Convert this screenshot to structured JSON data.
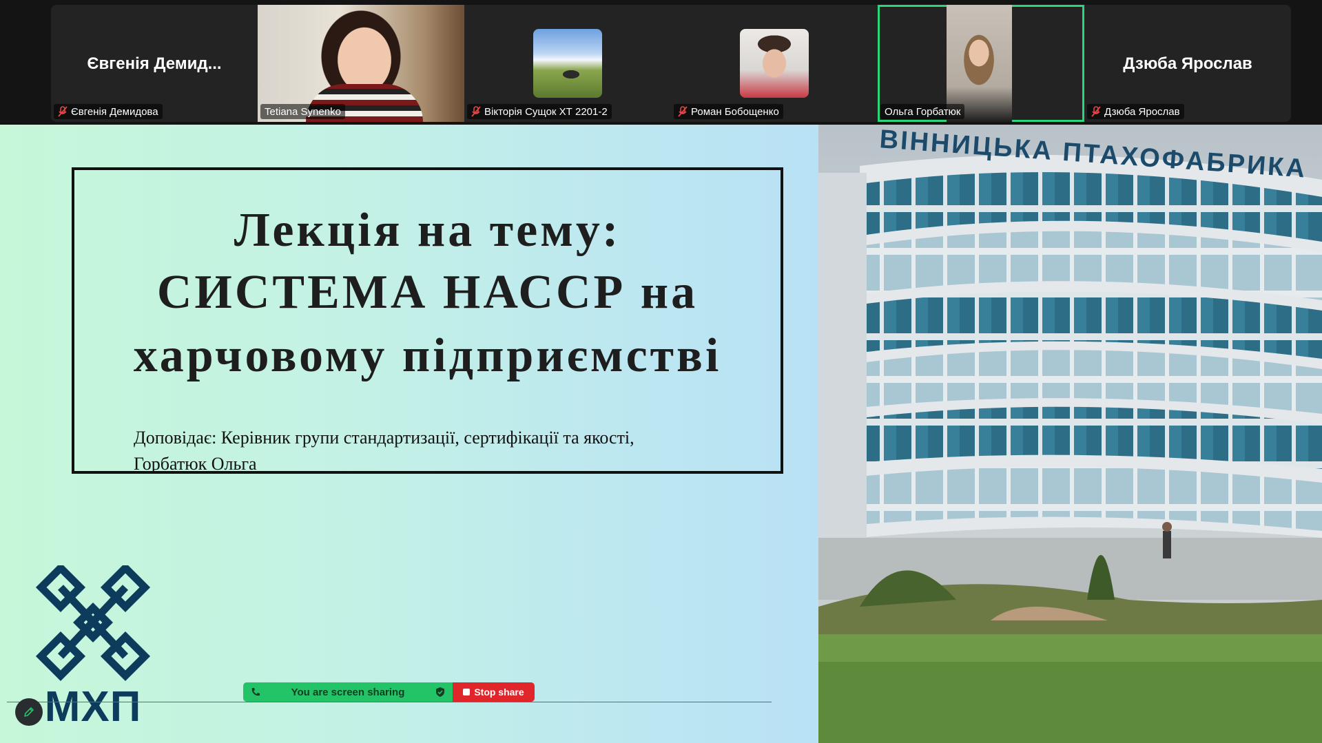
{
  "participants": [
    {
      "big_name": "Євгенія Демид...",
      "label": "Євгенія Демидова",
      "muted": true,
      "video": false
    },
    {
      "big_name": "",
      "label": "Tetiana Synenko",
      "muted": false,
      "video": true
    },
    {
      "big_name": "",
      "label": "Вікторія Сущок ХТ 2201-2",
      "muted": true,
      "video": false
    },
    {
      "big_name": "",
      "label": "Роман Бобощенко",
      "muted": true,
      "video": false
    },
    {
      "big_name": "",
      "label": "Ольга Горбатюк",
      "muted": false,
      "video": true,
      "active_speaker": true
    },
    {
      "big_name": "Дзюба Ярослав",
      "label": "Дзюба Ярослав",
      "muted": true,
      "video": false
    }
  ],
  "slide": {
    "title_line1": "Лекція на тему:",
    "title_line2": "СИСТЕМА НАССР на",
    "title_line3": "харчовому підприємстві",
    "presenter_line1": "Доповідає: Керівник групи стандартизації, сертифікації та якості,",
    "presenter_line2": "Горбатюк Ольга",
    "logo_text": "МХП",
    "photo_sign": "ВІННИЦЬКА ПТАХОФАБРИКА"
  },
  "share_bar": {
    "status": "You are screen sharing",
    "stop_label": "Stop share"
  },
  "colors": {
    "share_green": "#23c468",
    "stop_red": "#e0252b",
    "active_speaker": "#2bd67b",
    "logo_navy": "#0c3b5c"
  },
  "icons": {
    "muted": "mic-muted-icon",
    "share_status": "phone-icon",
    "shield": "shield-icon",
    "stop": "stop-square-icon",
    "annotate": "pencil-icon"
  }
}
